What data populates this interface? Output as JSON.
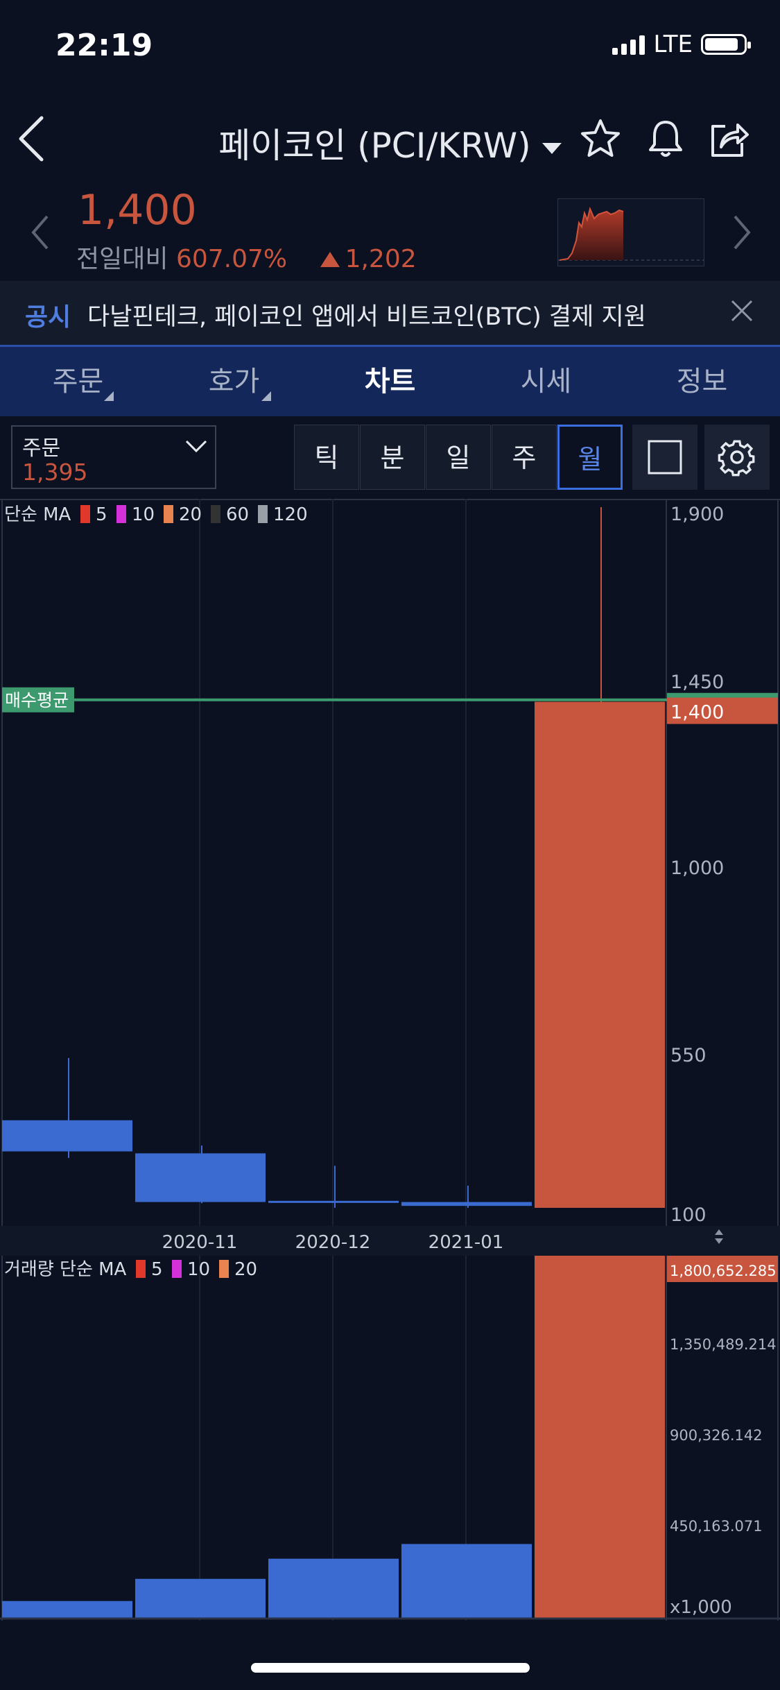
{
  "status_bar": {
    "time": "22:19",
    "network": "LTE"
  },
  "header": {
    "title": "페이코인 (PCI/KRW)"
  },
  "price": {
    "current": "1,400",
    "change_label": "전일대비",
    "change_percent": "607.07%",
    "change_amount": "1,202"
  },
  "notice": {
    "tag": "공시",
    "text": "다날핀테크, 페이코인 앱에서 비트코인(BTC) 결제 지원"
  },
  "tabs": [
    {
      "label": "주문"
    },
    {
      "label": "호가"
    },
    {
      "label": "차트"
    },
    {
      "label": "시세"
    },
    {
      "label": "정보"
    }
  ],
  "active_tab": "차트",
  "order": {
    "label": "주문",
    "value": "1,395"
  },
  "periods": [
    {
      "label": "틱"
    },
    {
      "label": "분"
    },
    {
      "label": "일"
    },
    {
      "label": "주"
    },
    {
      "label": "월"
    }
  ],
  "active_period": "월",
  "colors": {
    "up": "#c8553d",
    "down": "#3b6bd0",
    "avg_line": "#3d9a6e",
    "accent": "#3b6fe0"
  },
  "chart_data": [
    {
      "type": "candlestick",
      "legend_title": "단순 MA",
      "ma_legend": [
        {
          "label": "5",
          "color": "#e0392b"
        },
        {
          "label": "10",
          "color": "#d531d8"
        },
        {
          "label": "20",
          "color": "#e9834f"
        },
        {
          "label": "60",
          "color": "#333333"
        },
        {
          "label": "120",
          "color": "#9aa0a8"
        }
      ],
      "y_ticks": [
        "1,900",
        "1,450",
        "1,000",
        "550",
        "100"
      ],
      "y_range": [
        100,
        1900
      ],
      "x_tick_labels": [
        "2020-11",
        "2020-12",
        "2021-01"
      ],
      "candles": [
        {
          "open": 325,
          "close": 245,
          "high": 485,
          "low": 228,
          "dir": "down"
        },
        {
          "open": 240,
          "close": 115,
          "high": 260,
          "low": 112,
          "dir": "down"
        },
        {
          "open": 118,
          "close": 113,
          "high": 208,
          "low": 100,
          "dir": "down"
        },
        {
          "open": 115,
          "close": 105,
          "high": 157,
          "low": 100,
          "dir": "down"
        },
        {
          "open": 100,
          "close": 1400,
          "high": 1900,
          "low": 100,
          "dir": "up"
        }
      ],
      "avg_buy_label": "매수평균",
      "avg_buy_price": 1405,
      "current_price_label": "1,400",
      "current_price": 1400
    },
    {
      "type": "bar",
      "legend_title": "거래량 단순 MA",
      "ma_legend": [
        {
          "label": "5",
          "color": "#e0392b"
        },
        {
          "label": "10",
          "color": "#d531d8"
        },
        {
          "label": "20",
          "color": "#e9834f"
        }
      ],
      "y_ticks": [
        "1,800,652.285",
        "1,350,489.214",
        "900,326.142",
        "450,163.071",
        "x1,000"
      ],
      "y_range": [
        0,
        1800652.285
      ],
      "values": [
        87000,
        197000,
        297000,
        370000,
        1800652
      ],
      "dirs": [
        "down",
        "down",
        "down",
        "down",
        "up"
      ]
    }
  ]
}
